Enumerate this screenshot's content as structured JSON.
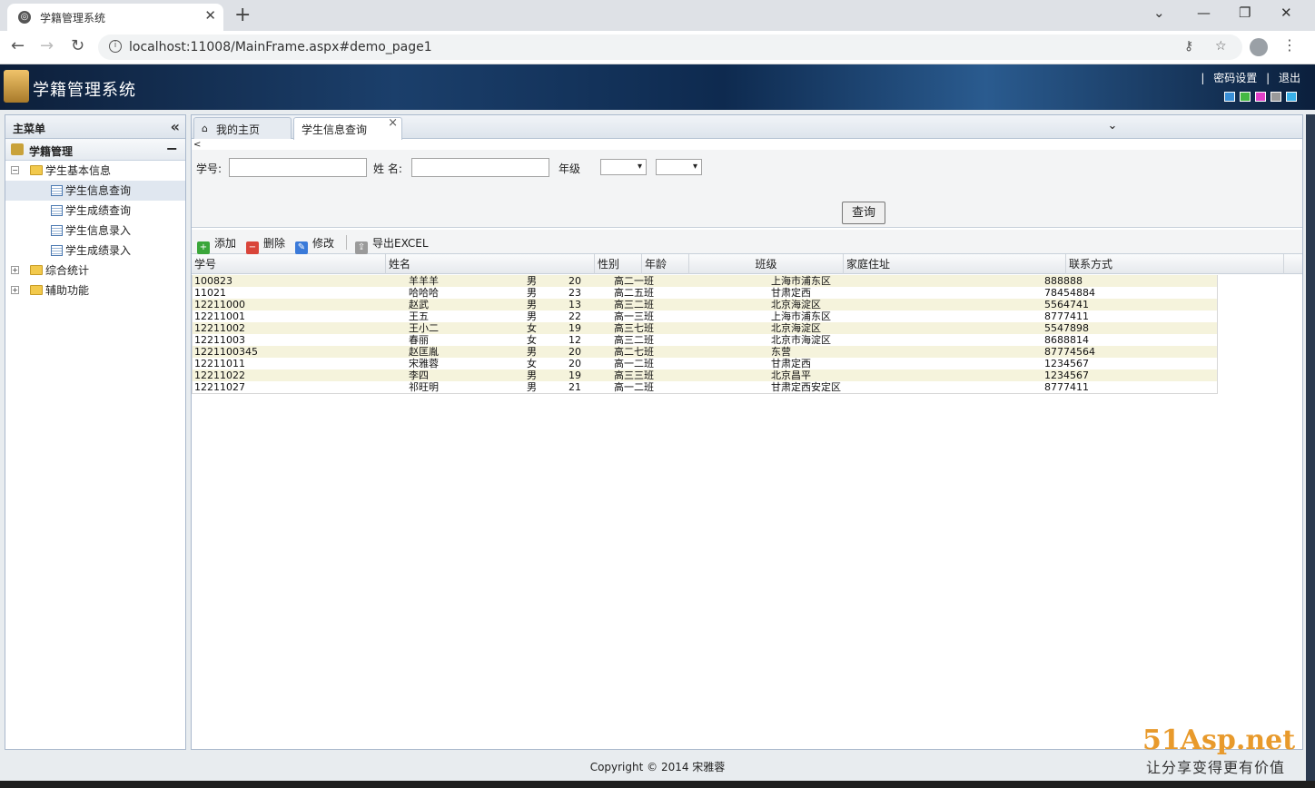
{
  "browser": {
    "tab_title": "学籍管理系统",
    "tab_close": "✕",
    "new_tab": "+",
    "url": "localhost:11008/MainFrame.aspx#demo_page1",
    "win_min": "—",
    "win_restore": "❐",
    "win_close": "✕",
    "tab_list": "⌄"
  },
  "header": {
    "title": "学籍管理系统",
    "sep1": "|",
    "password_link": "密码设置",
    "sep2": "|",
    "logout_link": "退出",
    "theme_colors": [
      "#3a8fd6",
      "#44b944",
      "#e040c8",
      "#9a9a9a",
      "#3ab0e8"
    ]
  },
  "sidebar": {
    "title": "主菜单",
    "collapse": "«",
    "section_title": "学籍管理",
    "section_toggle": "−",
    "items": [
      {
        "label": "学生基本信息"
      },
      {
        "label": "学生信息查询"
      },
      {
        "label": "学生成绩查询"
      },
      {
        "label": "学生信息录入"
      },
      {
        "label": "学生成绩录入"
      },
      {
        "label": "综合统计"
      },
      {
        "label": "辅助功能"
      }
    ]
  },
  "tabs": {
    "home": "我的主页",
    "active": "学生信息查询",
    "close": "×",
    "dropdown": "⌄"
  },
  "query": {
    "lt": "<",
    "student_no_label": "学号:",
    "name_label": "姓 名:",
    "grade_label": "年级",
    "select_arrow": "▾",
    "search_button": "查询"
  },
  "toolbar": {
    "add": "添加",
    "delete": "删除",
    "edit": "修改",
    "export": "导出EXCEL"
  },
  "table": {
    "columns": [
      "学号",
      "姓名",
      "性别",
      "年龄",
      "班级",
      "家庭住址",
      "联系方式"
    ],
    "rows": [
      [
        "100823",
        "羊羊羊",
        "男",
        "20",
        "高二一班",
        "上海市浦东区",
        "888888"
      ],
      [
        "11021",
        "哈哈哈",
        "男",
        "23",
        "高二五班",
        "甘肃定西",
        "78454884"
      ],
      [
        "12211000",
        "赵武",
        "男",
        "13",
        "高三二班",
        "北京海淀区",
        "5564741"
      ],
      [
        "12211001",
        "王五",
        "男",
        "22",
        "高一三班",
        "上海市浦东区",
        "8777411"
      ],
      [
        "12211002",
        "王小二",
        "女",
        "19",
        "高三七班",
        "北京海淀区",
        "5547898"
      ],
      [
        "12211003",
        "春丽",
        "女",
        "12",
        "高三二班",
        "北京市海淀区",
        "8688814"
      ],
      [
        "1221100345",
        "赵匡胤",
        "男",
        "20",
        "高二七班",
        "东营",
        "87774564"
      ],
      [
        "12211011",
        "宋雅蓉",
        "女",
        "20",
        "高一二班",
        "甘肃定西",
        "1234567"
      ],
      [
        "12211022",
        "李四",
        "男",
        "19",
        "高三三班",
        "北京昌平",
        "1234567"
      ],
      [
        "12211027",
        "祁旺明",
        "男",
        "21",
        "高一二班",
        "甘肃定西安定区",
        "8777411"
      ]
    ]
  },
  "footer": {
    "copyright": "Copyright © 2014 宋雅蓉"
  },
  "watermark": {
    "brand": "51Asp.net",
    "slogan": "让分享变得更有价值"
  }
}
